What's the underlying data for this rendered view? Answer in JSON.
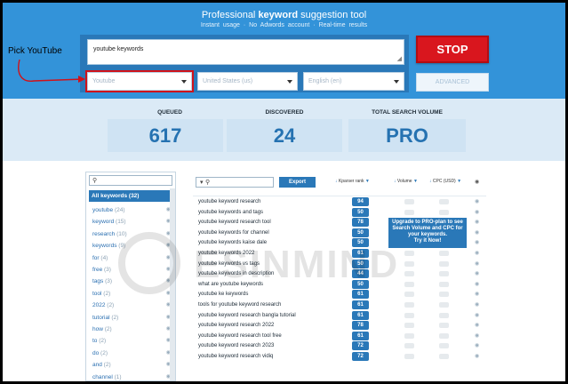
{
  "hero": {
    "title_pre": "Professional ",
    "title_bold": "keyword",
    "title_post": " suggestion tool",
    "subtitle": "Instant usage  ·  No Adwords account  ·  Real-time results"
  },
  "form": {
    "query": "youtube keywords",
    "source": "Youtube",
    "country": "United States (us)",
    "language": "English (en)",
    "stop_label": "STOP",
    "advanced_label": "ADVANCED"
  },
  "annotation": {
    "label": "Pick YouTube",
    "color": "#d0121a"
  },
  "stats": {
    "queued_label": "QUEUED",
    "queued_value": "617",
    "discovered_label": "DISCOVERED",
    "discovered_value": "24",
    "volume_label": "TOTAL SEARCH VOLUME",
    "volume_value": "PRO"
  },
  "sidebar": {
    "all_label": "All keywords (32)",
    "items": [
      {
        "word": "youtube",
        "count": "(24)"
      },
      {
        "word": "keyword",
        "count": "(15)"
      },
      {
        "word": "research",
        "count": "(10)"
      },
      {
        "word": "keywords",
        "count": "(9)"
      },
      {
        "word": "for",
        "count": "(4)"
      },
      {
        "word": "free",
        "count": "(3)"
      },
      {
        "word": "tags",
        "count": "(3)"
      },
      {
        "word": "tool",
        "count": "(2)"
      },
      {
        "word": "2022",
        "count": "(2)"
      },
      {
        "word": "tutorial",
        "count": "(2)"
      },
      {
        "word": "how",
        "count": "(2)"
      },
      {
        "word": "to",
        "count": "(2)"
      },
      {
        "word": "do",
        "count": "(2)"
      },
      {
        "word": "and",
        "count": "(2)"
      },
      {
        "word": "channel",
        "count": "(1)"
      }
    ]
  },
  "table": {
    "export_label": "Export",
    "col_rank": "Kparser rank",
    "col_volume": "Volume",
    "col_cpc": "CPC (USD)",
    "upgrade_pre": "Upgrade to ",
    "upgrade_bold": "PRO-plan",
    "upgrade_post": " to see Search Volume and CPC for your keywords.",
    "upgrade_cta": "Try it Now!",
    "rows": [
      {
        "kw": "youtube keyword research",
        "rank": "94"
      },
      {
        "kw": "youtube keywords and tags",
        "rank": "50"
      },
      {
        "kw": "youtube keyword research tool",
        "rank": "78"
      },
      {
        "kw": "youtube keywords for channel",
        "rank": "50"
      },
      {
        "kw": "youtube keywords kaise dale",
        "rank": "50"
      },
      {
        "kw": "youtube keywords 2022",
        "rank": "61"
      },
      {
        "kw": "youtube keywords vs tags",
        "rank": "50"
      },
      {
        "kw": "youtube keywords in description",
        "rank": "44"
      },
      {
        "kw": "what are youtube keywords",
        "rank": "50"
      },
      {
        "kw": "youtube ke keywords",
        "rank": "61"
      },
      {
        "kw": "tools for youtube keyword research",
        "rank": "61"
      },
      {
        "kw": "youtube keyword research bangla tutorial",
        "rank": "61"
      },
      {
        "kw": "youtube keyword research 2022",
        "rank": "78"
      },
      {
        "kw": "youtube keyword research tool free",
        "rank": "61"
      },
      {
        "kw": "youtube keyword research 2023",
        "rank": "72"
      },
      {
        "kw": "youtube keyword research vidiq",
        "rank": "72"
      }
    ]
  },
  "watermark": {
    "text": "ESINMIND"
  }
}
